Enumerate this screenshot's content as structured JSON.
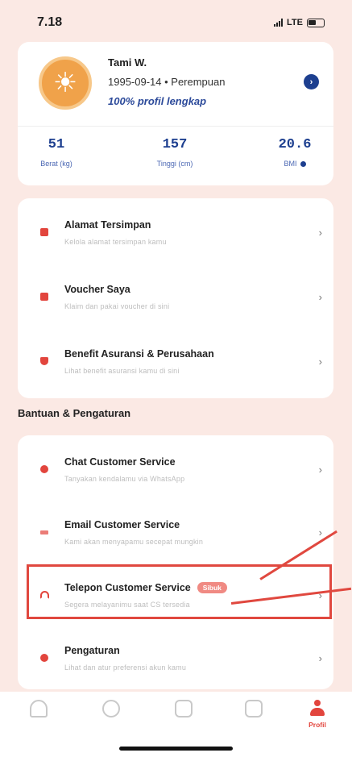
{
  "status_bar": {
    "time": "7.18",
    "network": "LTE"
  },
  "profile": {
    "name": "Tami W.",
    "dob_gender": "1995-09-14 • Perempuan",
    "completeness": "100% profil lengkap",
    "stats": [
      {
        "value": "51",
        "label": "Berat (kg)"
      },
      {
        "value": "157",
        "label": "Tinggi (cm)"
      },
      {
        "value": "20.6",
        "label": "BMI"
      }
    ]
  },
  "account_menu": [
    {
      "title": "Alamat Tersimpan",
      "subtitle": "Kelola alamat tersimpan kamu",
      "icon": "bookmark-icon"
    },
    {
      "title": "Voucher Saya",
      "subtitle": "Klaim dan pakai voucher di sini",
      "icon": "voucher-icon"
    },
    {
      "title": "Benefit Asuransi & Perusahaan",
      "subtitle": "Lihat benefit asuransi kamu di sini",
      "icon": "shield-icon"
    }
  ],
  "help_section_title": "Bantuan & Pengaturan",
  "help_menu": [
    {
      "title": "Chat Customer Service",
      "subtitle": "Tanyakan kendalamu via WhatsApp",
      "icon": "chat-icon"
    },
    {
      "title": "Email Customer Service",
      "subtitle": "Kami akan menyapamu secepat mungkin",
      "icon": "email-icon"
    },
    {
      "title": "Telepon Customer Service",
      "subtitle": "Segera melayanimu saat CS tersedia",
      "badge": "Sibuk",
      "icon": "headset-icon"
    },
    {
      "title": "Pengaturan",
      "subtitle": "Lihat dan atur preferensi akun kamu",
      "icon": "gear-icon"
    }
  ],
  "bottom_nav": {
    "items": [
      "home-icon",
      "chat-icon",
      "cart-icon",
      "records-icon"
    ],
    "active_label": "Profil"
  },
  "colors": {
    "accent": "#e2453d",
    "primary": "#1d3f8f",
    "background": "#fbe9e4"
  }
}
